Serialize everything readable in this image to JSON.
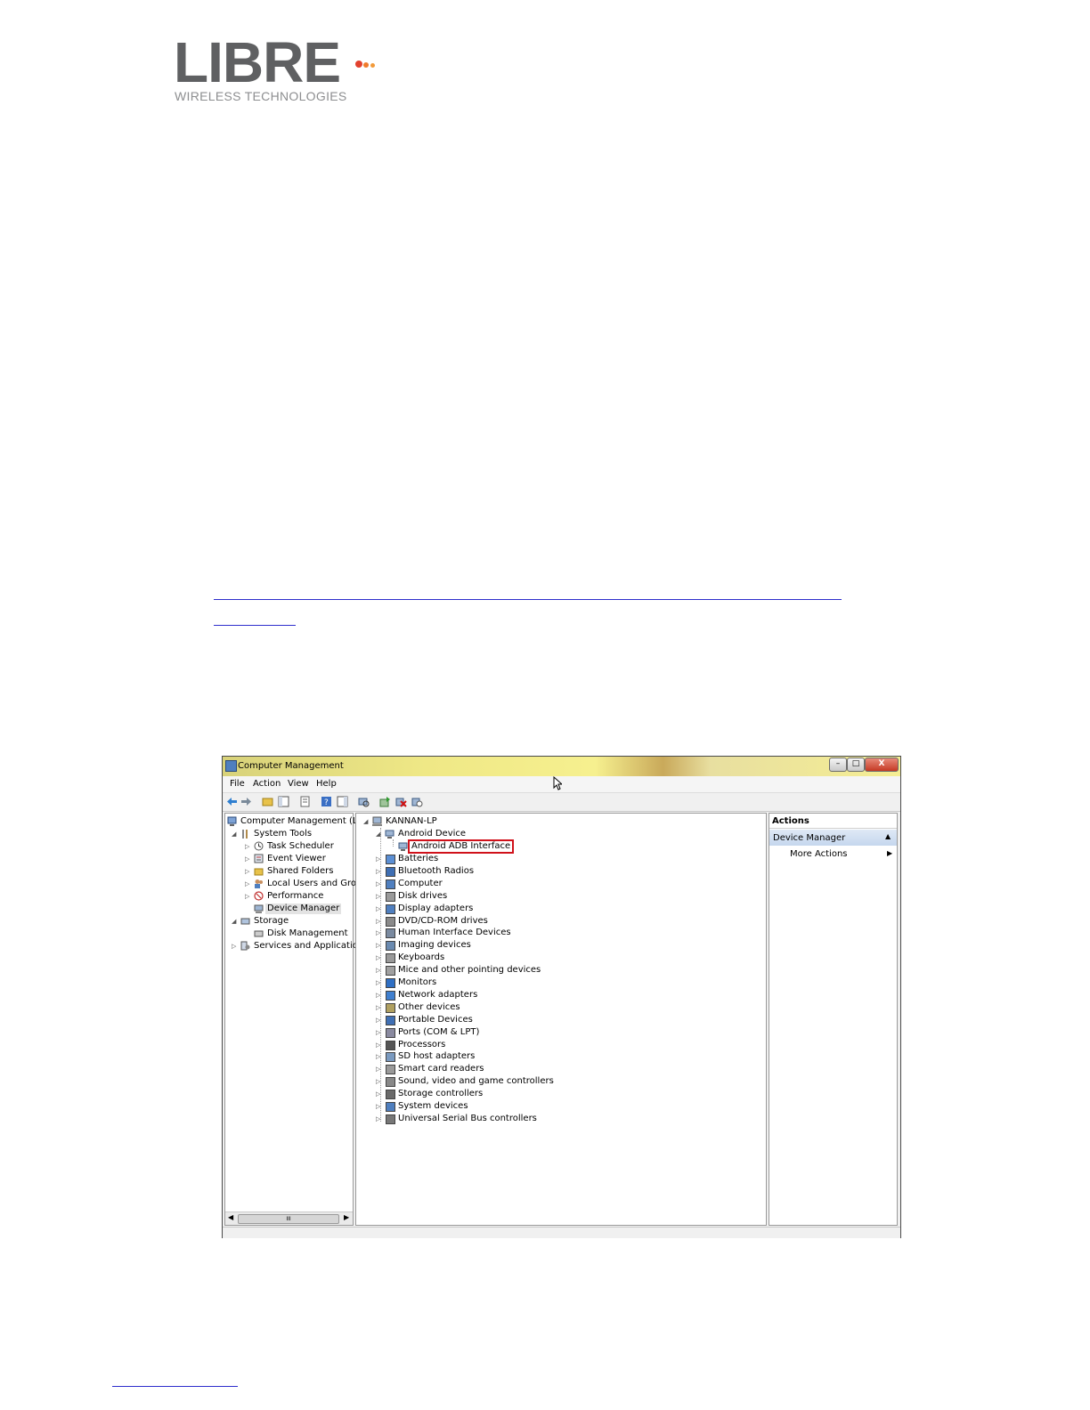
{
  "logo": {
    "main": "LIBRE",
    "sub": "WIRELESS TECHNOLOGIES",
    "dot_colors": [
      "#e2412e",
      "#f07a2b",
      "#f29a3a"
    ],
    "text_color": "#5f6062"
  },
  "window": {
    "title": "Computer Management",
    "buttons": [
      "–",
      "□",
      "X"
    ],
    "menu": [
      "File",
      "Action",
      "View",
      "Help"
    ],
    "toolbar_icons": [
      "back-icon",
      "forward-icon",
      "up-folder-icon",
      "show-hide-tree-icon",
      "properties-icon",
      "help-icon",
      "show-hide-action-pane-icon",
      "scan-hardware-icon",
      "update-driver-icon",
      "uninstall-icon",
      "disable-icon"
    ]
  },
  "left_tree": {
    "root": "Computer Management (Local",
    "items": [
      {
        "label": "System Tools",
        "expanded": true
      },
      {
        "label": "Task Scheduler"
      },
      {
        "label": "Event Viewer"
      },
      {
        "label": "Shared Folders"
      },
      {
        "label": "Local Users and Groups"
      },
      {
        "label": "Performance"
      },
      {
        "label": "Device Manager",
        "selected": true
      },
      {
        "label": "Storage",
        "expanded": true
      },
      {
        "label": "Disk Management"
      },
      {
        "label": "Services and Applications"
      }
    ],
    "scroll_label": "III"
  },
  "device_tree": {
    "root": "KANNAN-LP",
    "open_category": "Android Device",
    "highlighted_device": "Android ADB Interface",
    "highlight_color": "#d0111a",
    "categories": [
      "Batteries",
      "Bluetooth Radios",
      "Computer",
      "Disk drives",
      "Display adapters",
      "DVD/CD-ROM drives",
      "Human Interface Devices",
      "Imaging devices",
      "Keyboards",
      "Mice and other pointing devices",
      "Monitors",
      "Network adapters",
      "Other devices",
      "Portable Devices",
      "Ports (COM & LPT)",
      "Processors",
      "SD host adapters",
      "Smart card readers",
      "Sound, video and game controllers",
      "Storage controllers",
      "System devices",
      "Universal Serial Bus controllers"
    ]
  },
  "actions": {
    "header": "Actions",
    "selected": "Device Manager",
    "more": "More Actions"
  }
}
